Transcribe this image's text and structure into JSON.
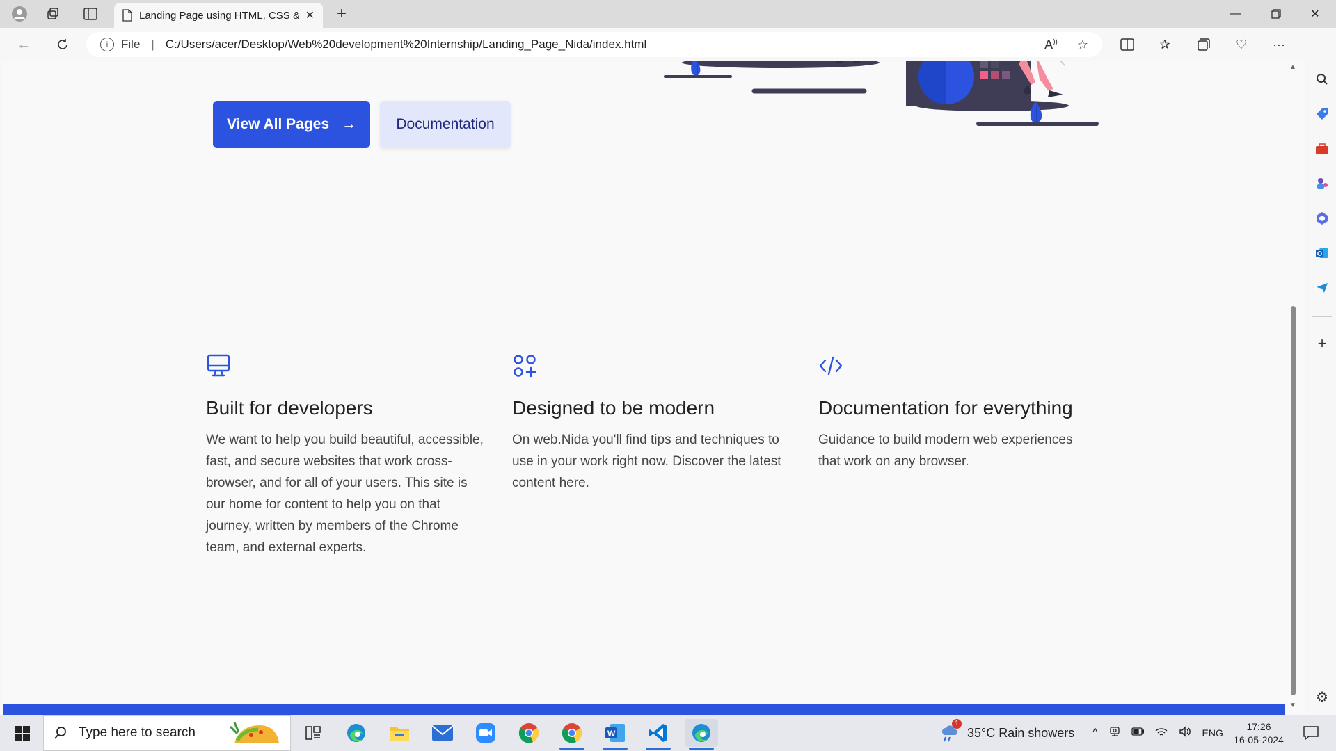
{
  "browser": {
    "tab_title": "Landing Page using HTML, CSS &",
    "address_label": "File",
    "url": "C:/Users/acer/Desktop/Web%20development%20Internship/Landing_Page_Nida/index.html"
  },
  "hero": {
    "primary_button": "View All Pages",
    "primary_arrow": "→",
    "secondary_button": "Documentation"
  },
  "features": [
    {
      "icon": "monitor-icon",
      "title": "Built for developers",
      "text": "We want to help you build beautiful, accessible, fast, and secure websites that work cross-browser, and for all of your users. This site is our home for content to help you on that journey, written by members of the Chrome team, and external experts."
    },
    {
      "icon": "apps-grid-icon",
      "title": "Designed to be modern",
      "text": "On web.Nida you'll find tips and techniques to use in your work right now. Discover the latest content here."
    },
    {
      "icon": "code-icon",
      "title": "Documentation for everything",
      "text": "Guidance to build modern web experiences that work on any browser."
    }
  ],
  "colors": {
    "accent": "#2b53e0",
    "secondary_button_bg": "#e3e7fb",
    "illustration_dark": "#3f3d56",
    "illustration_pink": "#f58d9e"
  },
  "taskbar": {
    "search_placeholder": "Type here to search",
    "weather": "35°C  Rain showers",
    "weather_badge": "1",
    "language": "ENG",
    "time": "17:26",
    "date": "16-05-2024"
  }
}
